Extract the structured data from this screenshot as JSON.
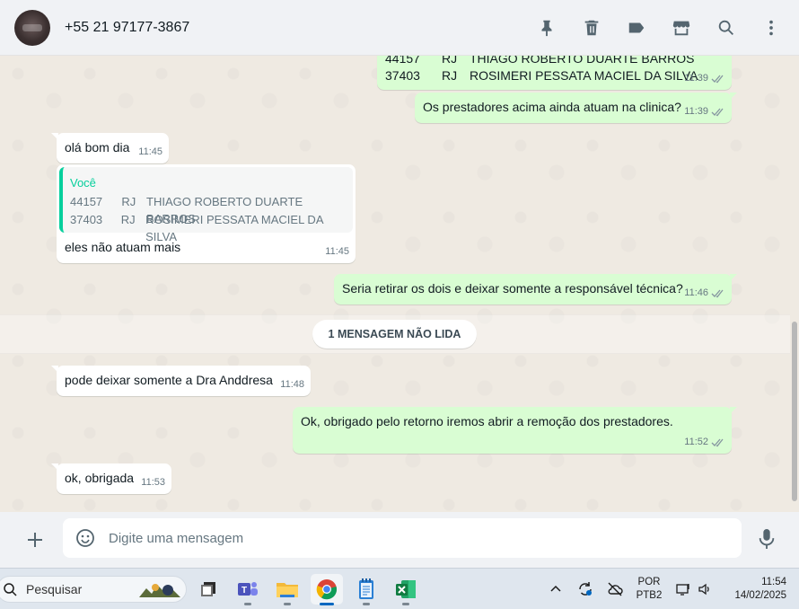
{
  "header": {
    "contact_name": "+55 21 97177-3867",
    "actions": [
      "pin-icon",
      "trash-icon",
      "label-icon",
      "store-icon",
      "search-icon",
      "more-icon"
    ]
  },
  "messages": {
    "m1": {
      "rows": [
        {
          "code": "44157",
          "uf": "RJ",
          "name": "THIAGO ROBERTO DUARTE BARROS"
        },
        {
          "code": "37403",
          "uf": "RJ",
          "name": "ROSIMERI PESSATA MACIEL DA SILVA"
        }
      ],
      "time": "11:39"
    },
    "m2": {
      "text": "Os prestadores acima ainda atuam na clinica?",
      "time": "11:39"
    },
    "m3": {
      "text": "olá bom dia",
      "time": "11:45"
    },
    "m4": {
      "quote_author": "Você",
      "quote_rows": [
        {
          "code": "44157",
          "uf": "RJ",
          "name": "THIAGO ROBERTO DUARTE BARROS"
        },
        {
          "code": "37403",
          "uf": "RJ",
          "name": "ROSIMERI PESSATA MACIEL DA SILVA"
        }
      ],
      "text": "eles não atuam mais",
      "time": "11:45"
    },
    "m5": {
      "text": "Seria retirar os dois e deixar somente a responsável técnica?",
      "time": "11:46"
    },
    "unread": "1 MENSAGEM NÃO LIDA",
    "m6": {
      "text": "pode deixar somente a Dra Anddresa",
      "time": "11:48"
    },
    "m7": {
      "text": "Ok, obrigado pelo retorno iremos abrir a remoção dos prestadores.",
      "time": "11:52"
    },
    "m8": {
      "text": "ok, obrigada",
      "time": "11:53"
    }
  },
  "composer": {
    "placeholder": "Digite uma mensagem"
  },
  "taskbar": {
    "search_label": "Pesquisar",
    "apps": [
      "task-view",
      "teams",
      "file-explorer",
      "chrome",
      "notepad",
      "excel"
    ],
    "lang_top": "POR",
    "lang_bottom": "PTB2",
    "time": "11:54",
    "date": "14/02/2025"
  },
  "colors": {
    "outgoing": "#d9fdd3",
    "incoming": "#ffffff",
    "accent": "#06cf9c",
    "chat_bg": "#efeae2"
  }
}
